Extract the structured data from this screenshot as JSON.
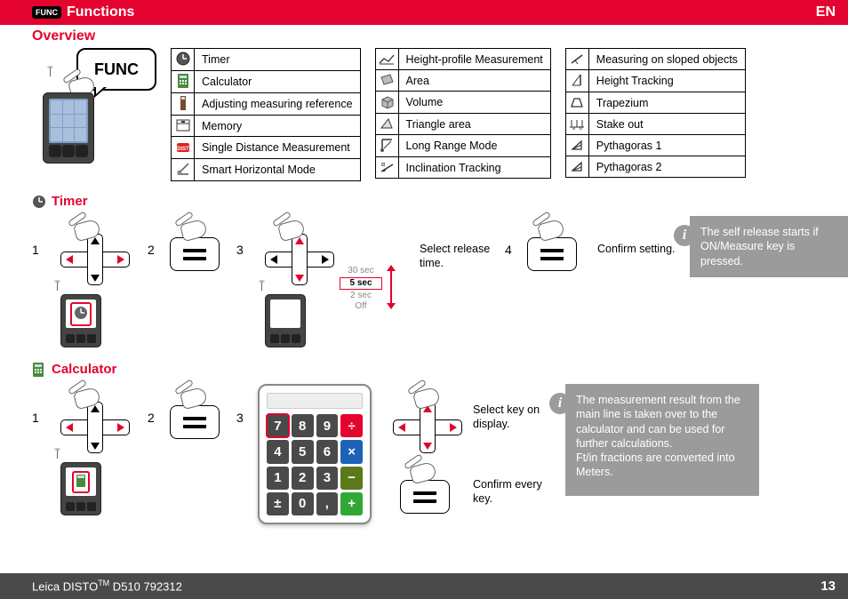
{
  "header": {
    "badge": "FUNC",
    "title": "Functions",
    "lang": "EN"
  },
  "overview": {
    "heading": "Overview",
    "func_label": "FUNC",
    "col1": [
      {
        "icon": "clock-icon",
        "label": "Timer"
      },
      {
        "icon": "calculator-icon",
        "label": "Calculator"
      },
      {
        "icon": "reference-icon",
        "label": "Adjusting measuring reference"
      },
      {
        "icon": "memory-icon",
        "label": "Memory"
      },
      {
        "icon": "dist-icon",
        "label": "Single Distance Measurement"
      },
      {
        "icon": "smart-horiz-icon",
        "label": "Smart Horizontal Mode"
      }
    ],
    "col2": [
      {
        "icon": "height-profile-icon",
        "label": "Height-profile Measurement"
      },
      {
        "icon": "area-icon",
        "label": "Area"
      },
      {
        "icon": "volume-icon",
        "label": "Volume"
      },
      {
        "icon": "triangle-area-icon",
        "label": "Triangle area"
      },
      {
        "icon": "long-range-icon",
        "label": "Long Range Mode"
      },
      {
        "icon": "inclination-icon",
        "label": "Inclination Tracking"
      }
    ],
    "col3": [
      {
        "icon": "sloped-icon",
        "label": "Measuring on sloped objects"
      },
      {
        "icon": "height-track-icon",
        "label": "Height Tracking"
      },
      {
        "icon": "trapezium-icon",
        "label": "Trapezium"
      },
      {
        "icon": "stakeout-icon",
        "label": "Stake out"
      },
      {
        "icon": "pyth1-icon",
        "label": "Pythagoras 1"
      },
      {
        "icon": "pyth2-icon",
        "label": "Pythagoras 2"
      }
    ]
  },
  "timer": {
    "heading": "Timer",
    "steps": {
      "1": "1",
      "2": "2",
      "3": "3",
      "4": "4"
    },
    "options": {
      "a": "30 sec",
      "b": "5 sec",
      "c": "2 sec",
      "d": "Off"
    },
    "step3_text": "Select release time.",
    "step4_text": "Confirm setting.",
    "info": "The self release starts if ON/Measure key is pressed."
  },
  "calculator": {
    "heading": "Calculator",
    "steps": {
      "1": "1",
      "2": "2",
      "3": "3"
    },
    "keys": [
      [
        "7",
        "8",
        "9",
        "÷"
      ],
      [
        "4",
        "5",
        "6",
        "×"
      ],
      [
        "1",
        "2",
        "3",
        "−"
      ],
      [
        "±",
        "0",
        ",",
        "+"
      ]
    ],
    "text_a": "Select key on display.",
    "text_b": "Confirm every key.",
    "info": "The measurement result from the main line is taken over to the calculator and can be used for further calculations.\nFt/in fractions are converted into Meters."
  },
  "footer": {
    "product": "Leica DISTO",
    "tm": "TM",
    "model": " D510 792312",
    "page": "13"
  }
}
